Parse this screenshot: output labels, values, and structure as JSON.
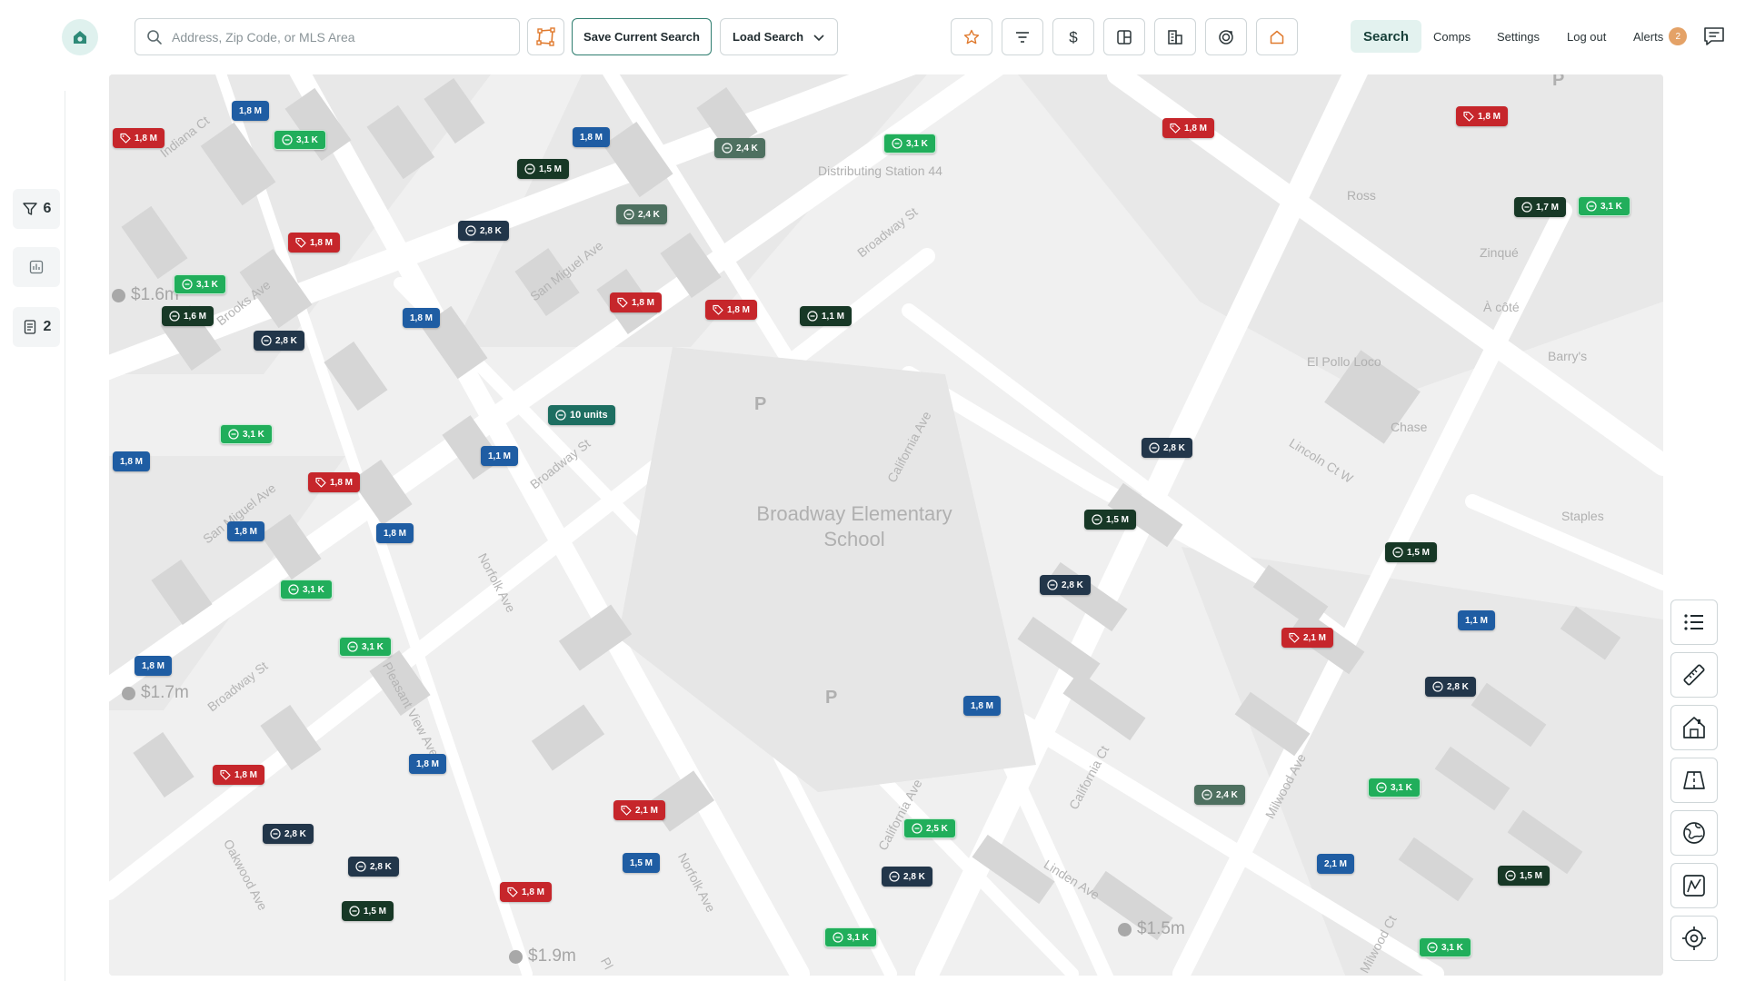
{
  "search": {
    "placeholder": "Address, Zip Code, or MLS Area",
    "value": ""
  },
  "toolbar": {
    "save_label": "Save Current Search",
    "load_label": "Load Search"
  },
  "nav": {
    "search": "Search",
    "comps": "Comps",
    "settings": "Settings",
    "logout": "Log out",
    "alerts": "Alerts",
    "alerts_count": "2"
  },
  "sidebar": {
    "filter_count": "6",
    "notes_count": "2"
  },
  "map": {
    "streets": [
      "Indiana Ct",
      "Brooks Ave",
      "San Miguel Ave",
      "Broadway St",
      "Broadway St",
      "San Miguel Ave",
      "Broadway St",
      "Norfolk Ave",
      "Pleasant View Ave",
      "Oakwood Ave",
      "Norfolk Ave",
      "California Ave",
      "California Ave",
      "California Ct",
      "Milwood Ave",
      "Milwood Ct",
      "Lincoln Ct W",
      "Linden Ave",
      "Pl"
    ],
    "pois": [
      "Distributing Station 44",
      "Ross",
      "Zinqué",
      "À côté",
      "El Pollo Loco",
      "Barry's",
      "Chase",
      "Staples",
      "Broadway Elementary School"
    ],
    "parking_label": "P",
    "area_prices": [
      "$1.6m",
      "$1.7m",
      "$1.9m",
      "$1.5m"
    ],
    "markers": [
      {
        "label": "1,8 M",
        "type": "blue"
      },
      {
        "label": "1,8 M",
        "type": "red"
      },
      {
        "label": "3,1 K",
        "type": "green"
      },
      {
        "label": "1,8 M",
        "type": "blue"
      },
      {
        "label": "1,5 M",
        "type": "dark"
      },
      {
        "label": "2,4 K",
        "type": "gray"
      },
      {
        "label": "3,1 K",
        "type": "green"
      },
      {
        "label": "1,8 M",
        "type": "red"
      },
      {
        "label": "1,8 M",
        "type": "red"
      },
      {
        "label": "2,8 K",
        "type": "navy"
      },
      {
        "label": "1,8 M",
        "type": "red"
      },
      {
        "label": "2,4 K",
        "type": "gray"
      },
      {
        "label": "1,7 M",
        "type": "dark"
      },
      {
        "label": "3,1 K",
        "type": "green"
      },
      {
        "label": "3,1 K",
        "type": "green"
      },
      {
        "label": "1,6 M",
        "type": "dark"
      },
      {
        "label": "1,8 M",
        "type": "blue"
      },
      {
        "label": "1,8 M",
        "type": "red"
      },
      {
        "label": "1,8 M",
        "type": "red"
      },
      {
        "label": "1,1 M",
        "type": "dark"
      },
      {
        "label": "2,8 K",
        "type": "navy"
      },
      {
        "label": "10 units",
        "type": "teal"
      },
      {
        "label": "3,1 K",
        "type": "green"
      },
      {
        "label": "1,8 M",
        "type": "blue"
      },
      {
        "label": "1,1 M",
        "type": "blue"
      },
      {
        "label": "1,8 M",
        "type": "red"
      },
      {
        "label": "2,8 K",
        "type": "navy"
      },
      {
        "label": "1,8 M",
        "type": "blue"
      },
      {
        "label": "1,8 M",
        "type": "blue"
      },
      {
        "label": "1,5 M",
        "type": "dark"
      },
      {
        "label": "1,5 M",
        "type": "dark"
      },
      {
        "label": "3,1 K",
        "type": "green"
      },
      {
        "label": "2,8 K",
        "type": "navy"
      },
      {
        "label": "1,1 M",
        "type": "blue"
      },
      {
        "label": "2,1 M",
        "type": "red"
      },
      {
        "label": "1,8 M",
        "type": "blue"
      },
      {
        "label": "3,1 K",
        "type": "green"
      },
      {
        "label": "2,8 K",
        "type": "navy"
      },
      {
        "label": "1,8 M",
        "type": "blue"
      },
      {
        "label": "1,8 M",
        "type": "blue"
      },
      {
        "label": "1,8 M",
        "type": "red"
      },
      {
        "label": "2,4 K",
        "type": "gray"
      },
      {
        "label": "3,1 K",
        "type": "green"
      },
      {
        "label": "2,1 M",
        "type": "red"
      },
      {
        "label": "2,5 K",
        "type": "green"
      },
      {
        "label": "2,8 K",
        "type": "navy"
      },
      {
        "label": "2,8 K",
        "type": "navy"
      },
      {
        "label": "1,5 M",
        "type": "blue"
      },
      {
        "label": "2,1 M",
        "type": "blue"
      },
      {
        "label": "1,5 M",
        "type": "dark"
      },
      {
        "label": "2,8 K",
        "type": "navy"
      },
      {
        "label": "1,8 M",
        "type": "red"
      },
      {
        "label": "1,5 M",
        "type": "dark"
      },
      {
        "label": "3,1 K",
        "type": "green"
      },
      {
        "label": "3,1 K",
        "type": "green"
      }
    ]
  },
  "tools": [
    "list-icon",
    "ruler-icon",
    "house-icon",
    "map-layers-icon",
    "globe-icon",
    "draw-area-icon",
    "locate-icon"
  ],
  "colors": {
    "accent": "#2e7d6f",
    "marker_blue": "#1f5da3",
    "marker_red": "#c6262b",
    "marker_green": "#21ae5b",
    "marker_navy": "#22364a",
    "marker_dark": "#173826",
    "marker_gray": "#4e7060",
    "marker_teal": "#1d6e61",
    "alert_badge": "#e4a267"
  }
}
